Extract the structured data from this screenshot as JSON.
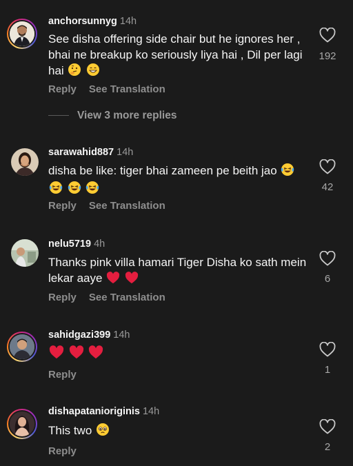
{
  "comments": [
    {
      "username": "anchorsunnyg",
      "time": "14h",
      "text": "See disha offering side chair but he ignores her , bhai ne breakup ko seriously liya hai , Dil per lagi hai",
      "emojis": [
        "thinking-face",
        "grinning-face"
      ],
      "likes": "192",
      "reply_label": "Reply",
      "translate_label": "See Translation"
    },
    {
      "username": "sarawahid887",
      "time": "14h",
      "text": "disha be like: tiger bhai zameen pe beith jao",
      "emojis": [
        "laughing-tears",
        "laughing-tears",
        "laughing-tears",
        "laughing-tears"
      ],
      "likes": "42",
      "reply_label": "Reply",
      "translate_label": "See Translation"
    },
    {
      "username": "nelu5719",
      "time": "4h",
      "text": "Thanks pink villa hamari Tiger Disha ko sath mein lekar aaye",
      "emojis": [
        "red-heart",
        "red-heart"
      ],
      "likes": "6",
      "reply_label": "Reply",
      "translate_label": "See Translation"
    },
    {
      "username": "sahidgazi399",
      "time": "14h",
      "text": "",
      "emojis": [
        "red-heart",
        "red-heart",
        "red-heart"
      ],
      "likes": "1",
      "reply_label": "Reply"
    },
    {
      "username": "dishapatanioriginis",
      "time": "14h",
      "text": "This two",
      "emojis": [
        "pleading-face"
      ],
      "likes": "2",
      "reply_label": "Reply"
    }
  ],
  "view_replies_label": "View 3 more replies",
  "colors": {
    "background": "#1b1b1b",
    "text": "#f5f5f5",
    "muted": "#8e8e8e",
    "heart": "#e41e3f",
    "emoji_yellow": "#ffcc33"
  }
}
